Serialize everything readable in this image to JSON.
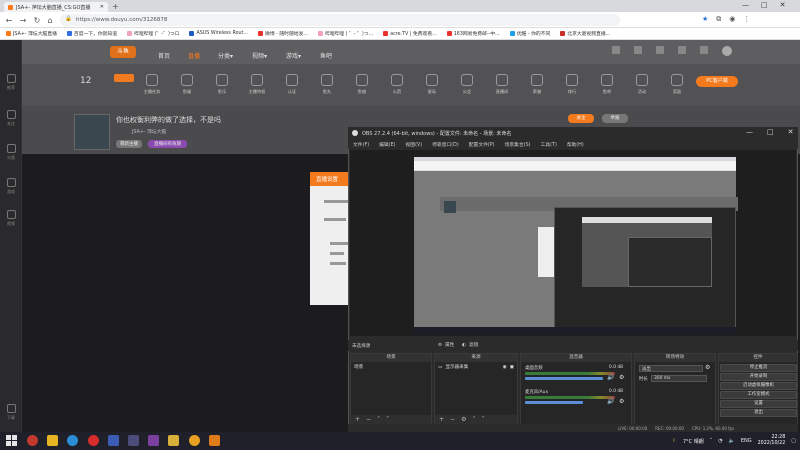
{
  "browser": {
    "active_tab_title": "JSA+- 萍坛大脑直播_CS:GO直播",
    "address": "https://www.douyu.com/3126878",
    "bookmarks": [
      "JSA+- 萍坛大脑直播",
      "百度一下，你就知道",
      "哔哩哔哩 (゜-゜)つロ",
      "ASUS Wireless Rout...",
      "微博 - 随时随地发...",
      "哔哩哔哩 ( ゜- ゜)つ...",
      "acre.TV | 免费观看...",
      "163网易免费邮--中...",
      "优酷 - 你的不同",
      "北京大厦视频直播..."
    ]
  },
  "douyu": {
    "logo": "斗鱼",
    "nav": [
      "首页",
      "直播",
      "分类▾",
      "视频▾",
      "游戏▾",
      "鱼吧"
    ],
    "left_sidebar": [
      "推荐",
      "关注",
      "分类",
      "游戏",
      "视频",
      "鱼吧",
      "下载"
    ],
    "badge_count": "12",
    "categories": [
      "主播任务",
      "鱼塘",
      "鱼乐",
      "主播特权",
      "认证",
      "鱼丸",
      "鱼翅",
      "火箭",
      "星际",
      "公会",
      "直播间",
      "荣誉",
      "排行",
      "鱼吧",
      "活动",
      "奖励"
    ],
    "room": {
      "title": "你也权衡利弊的做了选择，不是吗",
      "streamer": "JSA+- 萍坛大脑",
      "tag_1": "萌新主播",
      "tag_2": "直播间有效期",
      "follow_label": "关注",
      "report_label": "举报",
      "pc_client": "PC客户端"
    },
    "popup_title": "直播设置"
  },
  "obs": {
    "title": "OBS 27.2.4 (64-bit, windows) - 配置文件: 未命名 - 场景: 未命名",
    "menu": [
      "文件(F)",
      "编辑(E)",
      "视图(V)",
      "停靠窗口(D)",
      "配置文件(P)",
      "场景集合(S)",
      "工具(T)",
      "帮助(H)"
    ],
    "source_label": "未选择源",
    "props_label": "属性",
    "filters_label": "滤镜",
    "docks": {
      "scenes": {
        "title": "场景",
        "items": [
          "场景"
        ]
      },
      "sources": {
        "title": "来源",
        "items": [
          "显示器采集"
        ]
      },
      "mixer": {
        "title": "混音器",
        "channels": [
          {
            "name": "桌面音频",
            "db": "0.0 dB"
          },
          {
            "name": "麦克风/Aux",
            "db": "0.0 dB"
          }
        ]
      },
      "transitions": {
        "title": "转场特效",
        "type": "淡出",
        "duration_label": "时长",
        "duration": "300 ms"
      },
      "controls": {
        "title": "控件",
        "buttons": [
          "停止推流",
          "开始录制",
          "启动虚拟摄像机",
          "工作室模式",
          "设置",
          "退出"
        ]
      }
    },
    "status": {
      "live": "LIVE: 00:00:00",
      "rec": "REC: 00:00:00",
      "cpu": "CPU: 1.2%, 60.00 fps"
    }
  },
  "taskbar": {
    "weather": "7°C 晴朗",
    "lang": "ENG",
    "time": "22:28",
    "date": "2022/10/22"
  },
  "colors": {
    "accent": "#ff7a1a",
    "obs_bg": "#2b2b2b",
    "taskbar": "#20202a"
  }
}
